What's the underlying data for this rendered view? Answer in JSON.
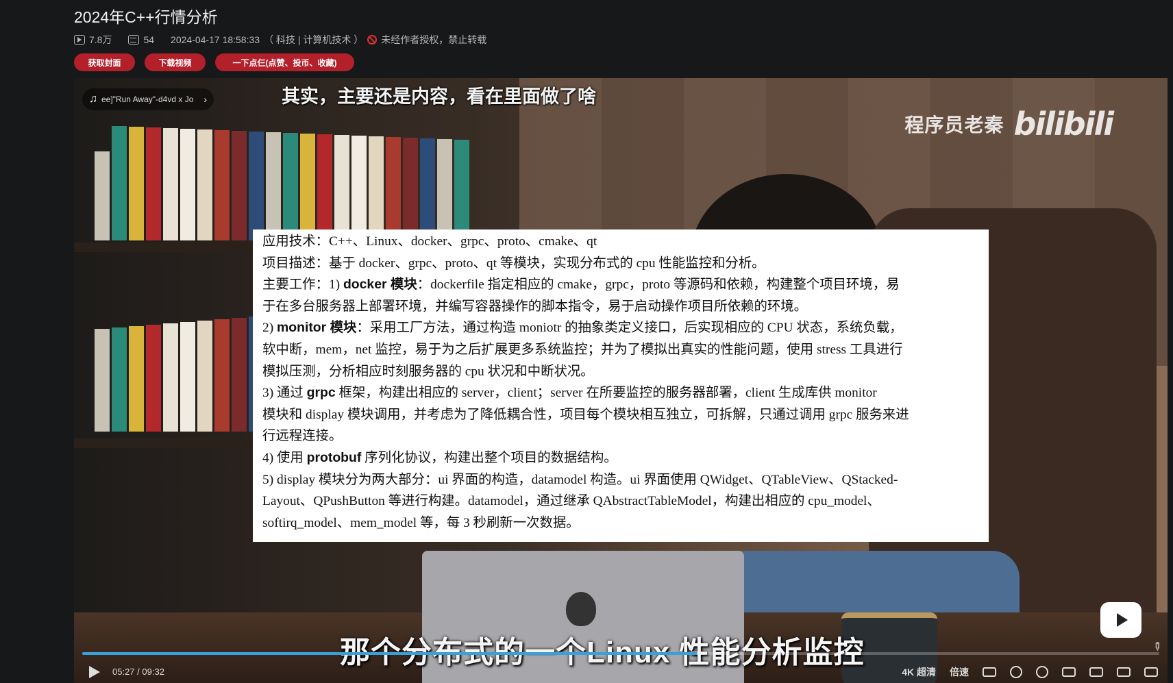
{
  "video": {
    "title": "2024年C++行情分析",
    "views": "7.8万",
    "danmaku": "54",
    "datetime": "2024-04-17 18:58:33",
    "category": "（ 科技 | 计算机技术 ）",
    "copyright": "未经作者授权，禁止转载"
  },
  "actions": {
    "cover_label": "获取封面",
    "download_label": "下载视频",
    "triple_label": "一下点仨(点赞、投币、收藏)"
  },
  "player": {
    "music_text": "ee]\"Run Away\"-d4vd x Jo",
    "caption_top": "其实，主要还是内容，看在里面做了啥",
    "watermark_name": "程序员老秦",
    "watermark_logo": "bilibili",
    "caption_bottom": "那个分布式的一个Linux 性能分析监控",
    "current_time": "05:27",
    "time_sep": "/",
    "duration": "09:32",
    "progress": 0.571,
    "quality_label": "4K 超清",
    "speed_label": "倍速"
  },
  "doc": {
    "lines": [
      {
        "pre": "应用技术：C++、Linux、docker、grpc、proto、cmake、qt",
        "bold": "",
        "post": ""
      },
      {
        "pre": "项目描述：基于 docker、grpc、proto、qt 等模块，实现分布式的 cpu 性能监控和分析。",
        "bold": "",
        "post": ""
      },
      {
        "pre": "主要工作：1) ",
        "bold": "docker 模块",
        "post": "：dockerfile 指定相应的 cmake，grpc，proto 等源码和依赖，构建整个项目环境，易"
      },
      {
        "pre": "于在多台服务器上部署环境，并编写容器操作的脚本指令，易于启动操作项目所依赖的环境。",
        "bold": "",
        "post": ""
      },
      {
        "pre": "2) ",
        "bold": "monitor 模块",
        "post": "：采用工厂方法，通过构造 moniotr 的抽象类定义接口，后实现相应的 CPU 状态，系统负载，"
      },
      {
        "pre": "软中断，mem，net 监控，易于为之后扩展更多系统监控；并为了模拟出真实的性能问题，使用 stress 工具进行",
        "bold": "",
        "post": ""
      },
      {
        "pre": "模拟压测，分析相应时刻服务器的 cpu 状况和中断状况。",
        "bold": "",
        "post": ""
      },
      {
        "pre": "3) 通过 ",
        "bold": "grpc",
        "post": " 框架，构建出相应的 server，client；server 在所要监控的服务器部署，client 生成库供 monitor"
      },
      {
        "pre": "模块和 display 模块调用，并考虑为了降低耦合性，项目每个模块相互独立，可拆解，只通过调用 grpc 服务来进",
        "bold": "",
        "post": ""
      },
      {
        "pre": "行远程连接。",
        "bold": "",
        "post": ""
      },
      {
        "pre": "4) 使用 ",
        "bold": "protobuf",
        "post": " 序列化协议，构建出整个项目的数据结构。"
      },
      {
        "pre": "5) display 模块分为两大部分：ui 界面的构造，datamodel 构造。ui 界面使用 QWidget、QTableView、QStacked-",
        "bold": "",
        "post": ""
      },
      {
        "pre": "Layout、QPushButton 等进行构建。datamodel，通过继承 QAbstractTableModel，构建出相应的 cpu_model、",
        "bold": "",
        "post": ""
      },
      {
        "pre": "softirq_model、mem_model 等，每 3 秒刷新一次数据。",
        "bold": "",
        "post": ""
      }
    ]
  },
  "colors": {
    "accent_button": "#b3202a",
    "progress": "#3aa0d9",
    "ban": "#e0312f"
  }
}
